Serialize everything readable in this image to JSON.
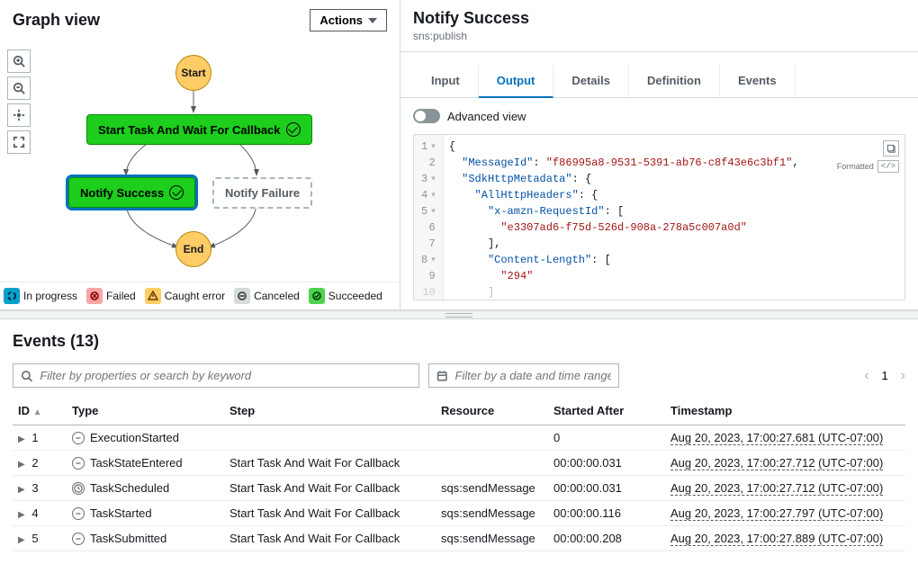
{
  "graph": {
    "title": "Graph view",
    "actions_label": "Actions",
    "start_label": "Start",
    "end_label": "End",
    "node_task": "Start Task And Wait For Callback",
    "node_success": "Notify Success",
    "node_failure": "Notify Failure",
    "legend": {
      "in_progress": "In progress",
      "failed": "Failed",
      "caught": "Caught error",
      "canceled": "Canceled",
      "succeeded": "Succeeded"
    }
  },
  "detail": {
    "title": "Notify Success",
    "subtitle": "sns:publish",
    "tabs": {
      "input": "Input",
      "output": "Output",
      "details": "Details",
      "definition": "Definition",
      "events": "Events"
    },
    "advanced_label": "Advanced view",
    "formatted_label": "Formatted",
    "code": {
      "l1": "{",
      "l2a": "\"MessageId\"",
      "l2b": ": ",
      "l2c": "\"f86995a8-9531-5391-ab76-c8f43e6c3bf1\"",
      "l2d": ",",
      "l3a": "\"SdkHttpMetadata\"",
      "l3b": ": {",
      "l4a": "\"AllHttpHeaders\"",
      "l4b": ": {",
      "l5a": "\"x-amzn-RequestId\"",
      "l5b": ": [",
      "l6": "\"e3307ad6-f75d-526d-908a-278a5c007a0d\"",
      "l7": "],",
      "l8a": "\"Content-Length\"",
      "l8b": ": [",
      "l9": "\"294\"",
      "l10": "]"
    }
  },
  "events": {
    "title": "Events (13)",
    "filter_placeholder": "Filter by properties or search by keyword",
    "date_placeholder": "Filter by a date and time range",
    "page": "1",
    "headers": {
      "id": "ID",
      "type": "Type",
      "step": "Step",
      "resource": "Resource",
      "started": "Started After",
      "timestamp": "Timestamp"
    },
    "rows": [
      {
        "id": "1",
        "type": "ExecutionStarted",
        "step": "",
        "resource": "",
        "started": "0",
        "ts": "Aug 20, 2023, 17:00:27.681 (UTC-07:00)",
        "icon": "minus"
      },
      {
        "id": "2",
        "type": "TaskStateEntered",
        "step": "Start Task And Wait For Callback",
        "resource": "",
        "started": "00:00:00.031",
        "ts": "Aug 20, 2023, 17:00:27.712 (UTC-07:00)",
        "icon": "minus"
      },
      {
        "id": "3",
        "type": "TaskScheduled",
        "step": "Start Task And Wait For Callback",
        "resource": "sqs:sendMessage",
        "started": "00:00:00.031",
        "ts": "Aug 20, 2023, 17:00:27.712 (UTC-07:00)",
        "icon": "clock"
      },
      {
        "id": "4",
        "type": "TaskStarted",
        "step": "Start Task And Wait For Callback",
        "resource": "sqs:sendMessage",
        "started": "00:00:00.116",
        "ts": "Aug 20, 2023, 17:00:27.797 (UTC-07:00)",
        "icon": "minus"
      },
      {
        "id": "5",
        "type": "TaskSubmitted",
        "step": "Start Task And Wait For Callback",
        "resource": "sqs:sendMessage",
        "started": "00:00:00.208",
        "ts": "Aug 20, 2023, 17:00:27.889 (UTC-07:00)",
        "icon": "minus"
      }
    ]
  }
}
